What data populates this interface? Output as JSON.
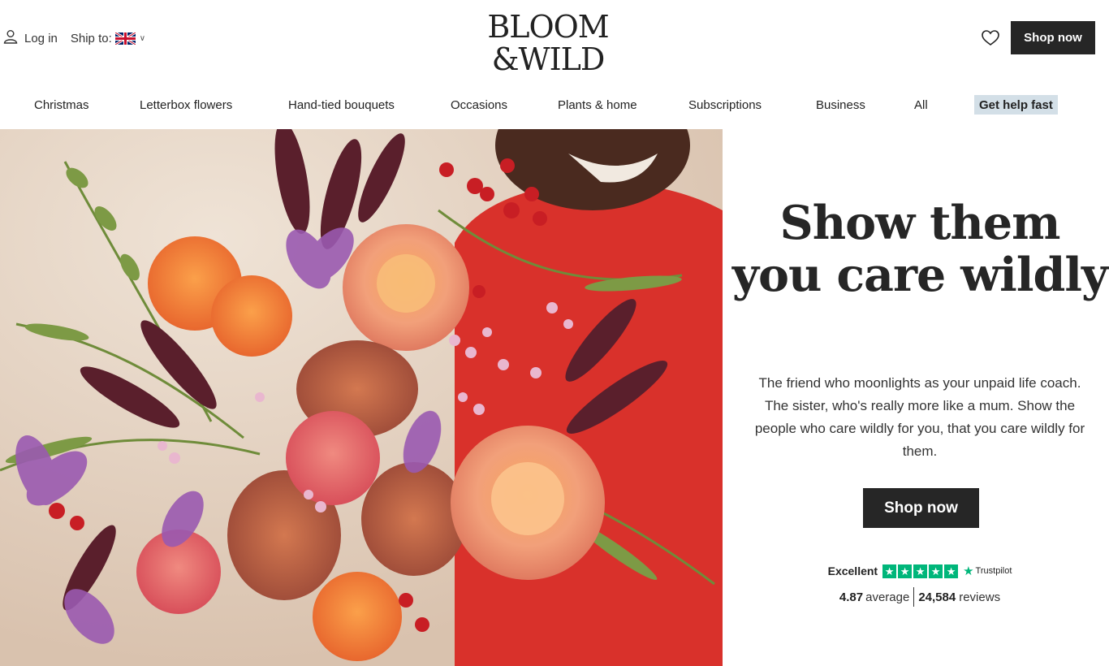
{
  "header": {
    "login_label": "Log in",
    "ship_label": "Ship to:",
    "ship_country_icon": "uk-flag-icon",
    "logo_text_line1": "BLOOM",
    "logo_text_line2": "&WILD",
    "shop_now_label": "Shop now"
  },
  "nav": {
    "items": [
      {
        "label": "Christmas"
      },
      {
        "label": "Letterbox flowers"
      },
      {
        "label": "Hand-tied bouquets"
      },
      {
        "label": "Occasions"
      },
      {
        "label": "Plants & home"
      },
      {
        "label": "Subscriptions"
      },
      {
        "label": "Business"
      },
      {
        "label": "All"
      }
    ],
    "help_label": "Get help fast"
  },
  "hero": {
    "headline": "Show them you care wildly",
    "body": "The friend who moonlights as your unpaid life coach. The sister, who's really more like a mum. Show the people who care wildly for you, that you care wildly for them.",
    "cta_label": "Shop now",
    "trustpilot": {
      "label": "Excellent",
      "brand": "Trustpilot",
      "stars": 5,
      "average_value": "4.87",
      "average_label": "average",
      "reviews_value": "24,584",
      "reviews_label": "reviews"
    }
  },
  "colors": {
    "dark_button": "#262626",
    "help_bg": "#d3dfe7",
    "trustpilot_green": "#00b67a"
  }
}
